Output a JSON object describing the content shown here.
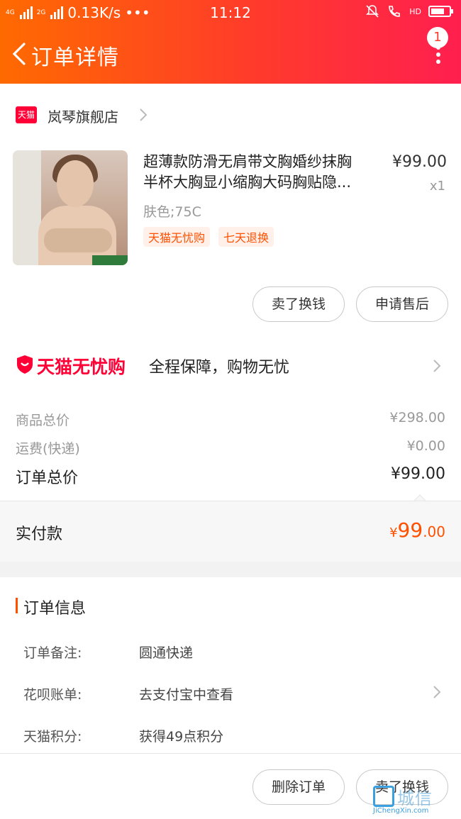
{
  "status_bar": {
    "network_left": "4G",
    "network_left2": "4G",
    "network_right": "2G",
    "speed": "0.13K/s",
    "dots": "•••",
    "time": "11:12",
    "hd": "HD"
  },
  "nav": {
    "title": "订单详情",
    "badge_count": "1"
  },
  "store": {
    "logo_text": "天猫",
    "name": "岚琴旗舰店"
  },
  "product": {
    "title_line1": "超薄款防滑无肩带文胸婚纱抹胸",
    "title_line2": "半杯大胸显小缩胸大码胸贴隐...",
    "price": "¥99.00",
    "qty": "x1",
    "sku": "肤色;75C",
    "tags": [
      "天猫无忧购",
      "七天退换"
    ]
  },
  "actions": {
    "sell_label": "卖了换钱",
    "after_sale_label": "申请售后"
  },
  "guarantee": {
    "brand": "天猫无忧购",
    "text": "全程保障，购物无忧"
  },
  "pricing": {
    "goods_total_label": "商品总价",
    "goods_total_value": "¥298.00",
    "shipping_label": "运费(快递)",
    "shipping_value": "¥0.00",
    "order_total_label": "订单总价",
    "order_total_value": "¥99.00",
    "paid_label": "实付款",
    "paid_currency": "¥",
    "paid_int": "99",
    "paid_dec": ".00"
  },
  "order_info": {
    "title": "订单信息",
    "rows": [
      {
        "key": "订单备注:",
        "value": "圆通快递"
      },
      {
        "key": "花呗账单:",
        "value": "去支付宝中查看"
      },
      {
        "key": "天猫积分:",
        "value": "获得49点积分"
      }
    ]
  },
  "bottom_bar": {
    "delete_label": "删除订单",
    "sell_label": "卖了换钱"
  },
  "watermark": {
    "cn": "城信",
    "en": "JiChengXin.com"
  },
  "colors": {
    "accent": "#ff5000",
    "tmall_red": "#ff0036",
    "header_start": "#ff6a00",
    "header_end": "#ff1f4f"
  }
}
